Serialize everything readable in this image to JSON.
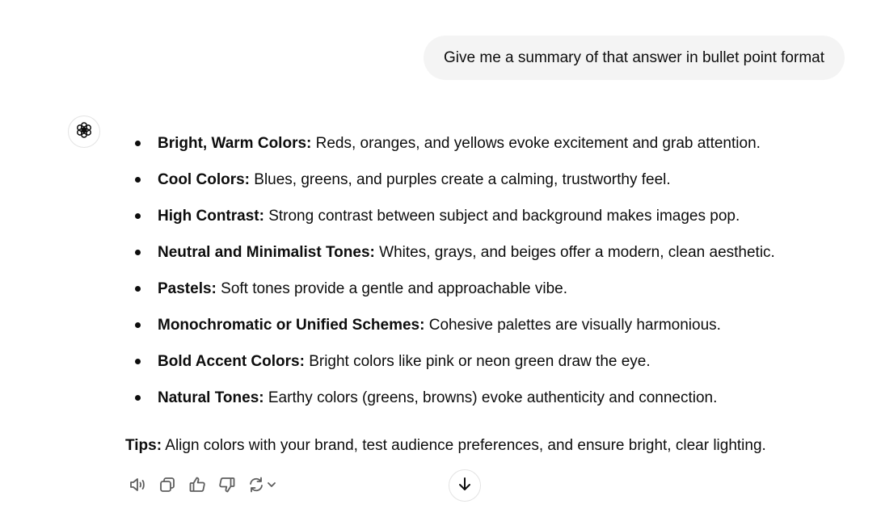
{
  "user_message": {
    "text": "Give me a summary of that answer in bullet point format"
  },
  "assistant": {
    "avatar_icon": "openai-logo-icon",
    "bullets": [
      {
        "label": "Bright, Warm Colors:",
        "text": " Reds, oranges, and yellows evoke excitement and grab attention."
      },
      {
        "label": "Cool Colors:",
        "text": " Blues, greens, and purples create a calming, trustworthy feel."
      },
      {
        "label": "High Contrast:",
        "text": " Strong contrast between subject and background makes images pop."
      },
      {
        "label": "Neutral and Minimalist Tones:",
        "text": " Whites, grays, and beiges offer a modern, clean aesthetic."
      },
      {
        "label": "Pastels:",
        "text": " Soft tones provide a gentle and approachable vibe."
      },
      {
        "label": "Monochromatic or Unified Schemes:",
        "text": " Cohesive palettes are visually harmonious."
      },
      {
        "label": "Bold Accent Colors:",
        "text": " Bright colors like pink or neon green draw the eye."
      },
      {
        "label": "Natural Tones:",
        "text": " Earthy colors (greens, browns) evoke authenticity and connection."
      }
    ],
    "tips": {
      "label": "Tips:",
      "text": " Align colors with your brand, test audience preferences, and ensure bright, clear lighting."
    }
  },
  "actions": {
    "icons": [
      "read-aloud-icon",
      "copy-icon",
      "thumbs-up-icon",
      "thumbs-down-icon",
      "regenerate-icon"
    ]
  },
  "scroll_button": {
    "icon": "arrow-down-icon"
  },
  "colors": {
    "bubble_background": "#f4f4f4",
    "text": "#0d0d0d",
    "icon": "#5d5d5d",
    "border": "#e3e3e3"
  }
}
